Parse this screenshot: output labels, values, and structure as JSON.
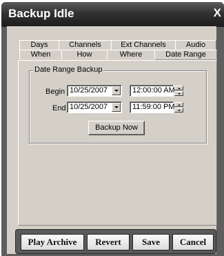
{
  "window": {
    "title": "Backup Idle",
    "close_glyph": "X",
    "close_icon": "close-icon"
  },
  "tabs": {
    "row_back": [
      {
        "label": "Days"
      },
      {
        "label": "Channels"
      },
      {
        "label": "Ext Channels"
      },
      {
        "label": "Audio"
      }
    ],
    "row_front": [
      {
        "label": "When"
      },
      {
        "label": "How"
      },
      {
        "label": "Where"
      },
      {
        "label": "Date Range",
        "active": true
      }
    ]
  },
  "date_range": {
    "group_label": "Date Range Backup",
    "begin": {
      "label": "Begin",
      "date": "10/25/2007",
      "time": "12:00:00 AM"
    },
    "end": {
      "label": "End",
      "date": "10/25/2007",
      "time": "11:59:00 PM"
    },
    "backup_now_label": "Backup Now"
  },
  "actions": {
    "play_archive": "Play Archive",
    "revert": "Revert",
    "save": "Save",
    "cancel": "Cancel"
  },
  "colors": {
    "titlebar": "#1c1c1c",
    "frame": "#5e5e5e",
    "client_bg": "#d4d0c8"
  }
}
